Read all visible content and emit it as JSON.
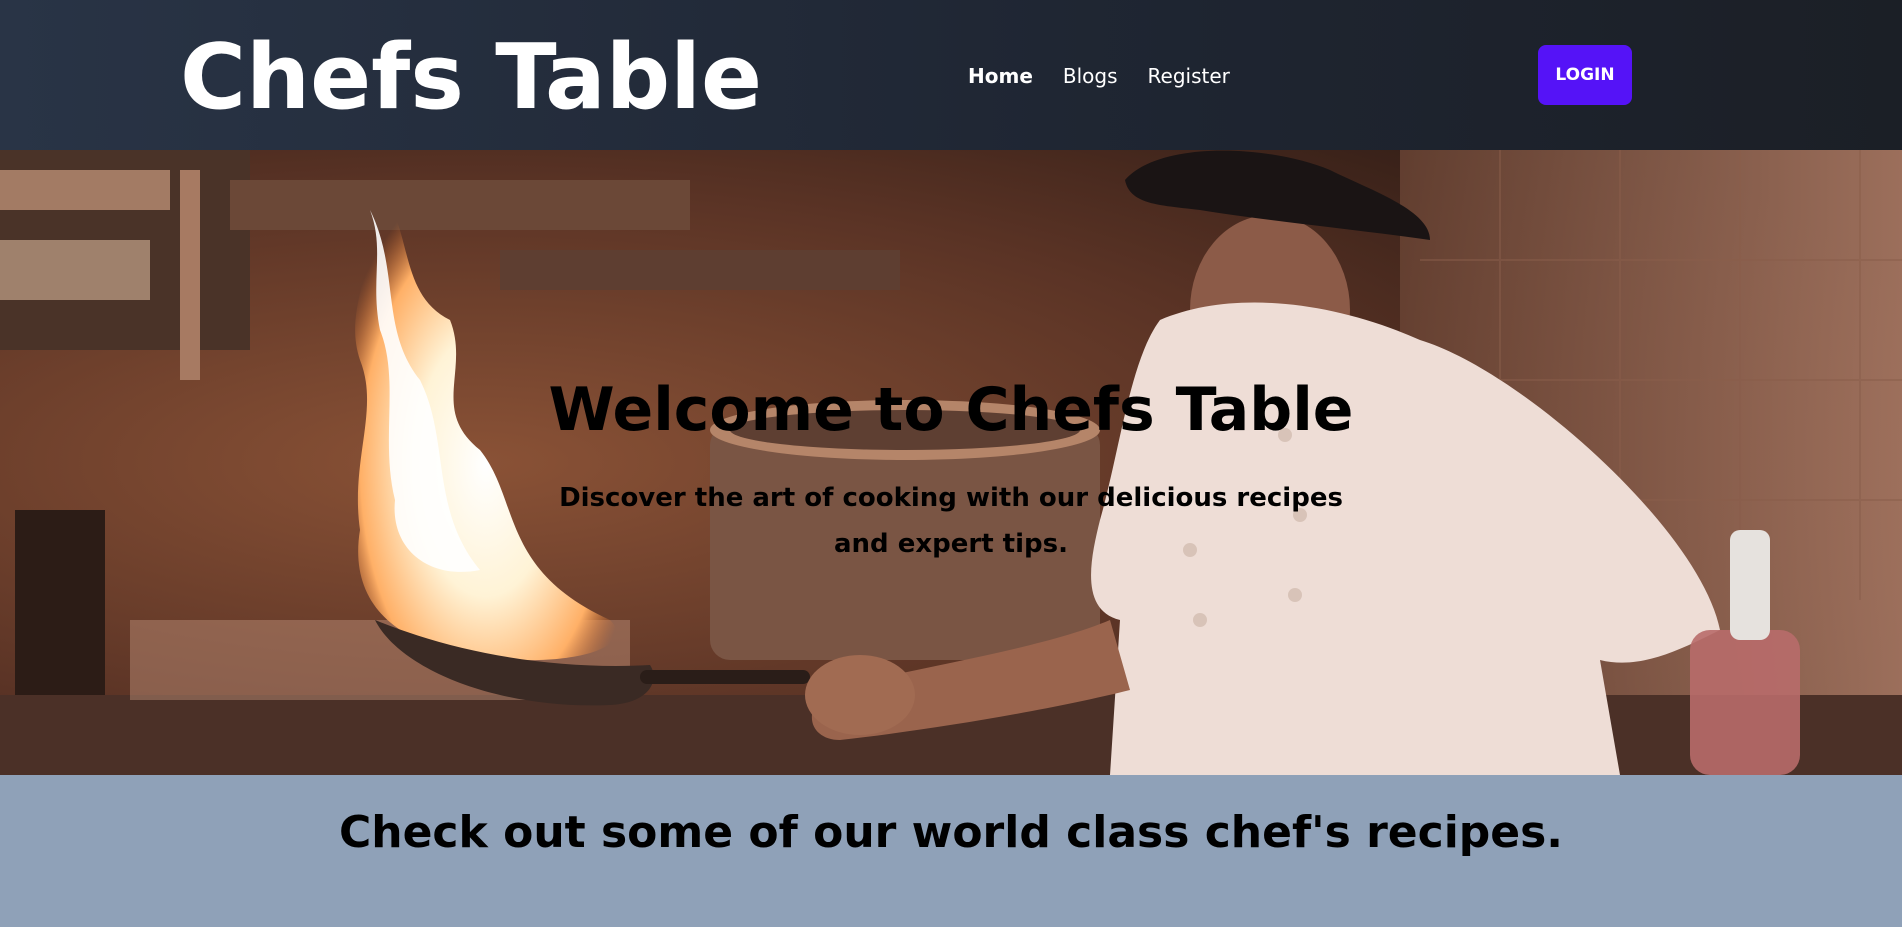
{
  "header": {
    "brand": "Chefs Table",
    "nav": [
      {
        "label": "Home",
        "active": true
      },
      {
        "label": "Blogs",
        "active": false
      },
      {
        "label": "Register",
        "active": false
      }
    ],
    "login_label": "LOGIN"
  },
  "hero": {
    "title": "Welcome to Chefs Table",
    "subtitle": "Discover the art of cooking with our delicious recipes and expert tips.",
    "image": "chef-flambe-photo"
  },
  "recipes": {
    "heading": "Check out some of our world class chef's recipes."
  },
  "colors": {
    "header_bg": "#1f2633",
    "accent": "#5513f7",
    "section_bg": "#8fa1b8"
  }
}
